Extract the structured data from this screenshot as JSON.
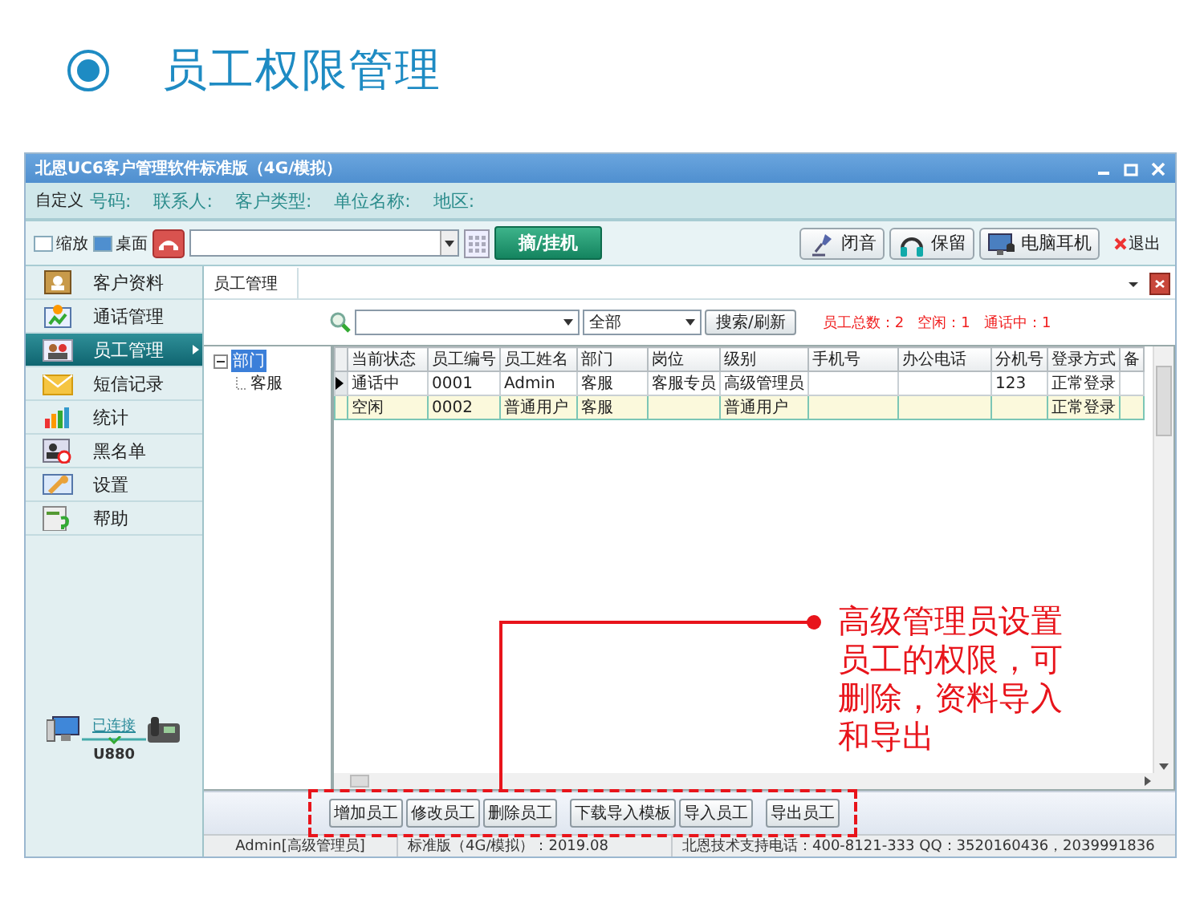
{
  "heading": {
    "title": "员工权限管理"
  },
  "window": {
    "title": "北恩UC6客户管理软件标准版（4G/模拟）"
  },
  "field_bar": {
    "custom": "自定义",
    "labels": [
      "号码:",
      "联系人:",
      "客户类型:",
      "单位名称:",
      "地区:"
    ]
  },
  "toolbar": {
    "checkboxes": [
      {
        "label": "缩放",
        "checked": false
      },
      {
        "label": "桌面",
        "checked": true
      }
    ],
    "dial_button": "摘/挂机",
    "buttons": [
      "闭音",
      "保留",
      "电脑耳机"
    ],
    "exit": "退出"
  },
  "sidebar": {
    "items": [
      {
        "label": "客户资料",
        "selected": false
      },
      {
        "label": "通话管理",
        "selected": false
      },
      {
        "label": "员工管理",
        "selected": true
      },
      {
        "label": "短信记录",
        "selected": false
      },
      {
        "label": "统计",
        "selected": false
      },
      {
        "label": "黑名单",
        "selected": false
      },
      {
        "label": "设置",
        "selected": false
      },
      {
        "label": "帮助",
        "selected": false
      }
    ],
    "connection": {
      "status": "已连接",
      "device": "U880"
    }
  },
  "tab": {
    "label": "员工管理",
    "selected": true
  },
  "search": {
    "department": "全部",
    "button": "搜索/刷新",
    "stats": "员工总数：2   空闲：1   通话中：1"
  },
  "tree": {
    "label": "部门",
    "selected": true,
    "expanded": true,
    "children": [
      {
        "label": "客服"
      }
    ]
  },
  "table": {
    "columns": [
      "当前状态",
      "员工编号",
      "员工姓名",
      "部门",
      "岗位",
      "级别",
      "手机号",
      "办公电话",
      "分机号",
      "登录方式",
      "备"
    ],
    "rows": [
      {
        "cells": [
          "通话中",
          "0001",
          "Admin",
          "客服",
          "客服专员",
          "高级管理员",
          "",
          "",
          "123",
          "正常登录",
          ""
        ],
        "current": true,
        "selected": false
      },
      {
        "cells": [
          "空闲",
          "0002",
          "普通用户",
          "客服",
          "",
          "普通用户",
          "",
          "",
          "",
          "正常登录",
          ""
        ],
        "current": false,
        "selected": true
      }
    ]
  },
  "buttons": [
    "增加员工",
    "修改员工",
    "删除员工",
    "下载导入模板",
    "导入员工",
    "导出员工"
  ],
  "status_bar": [
    "Admin[高级管理员]",
    "标准版（4G/模拟）：2019.08",
    "北恩技术支持电话：400-8121-333  QQ：3520160436，2039991836"
  ],
  "annotation": {
    "text": "高级管理员设置员工的权限，可删除，资料导入和导出"
  }
}
